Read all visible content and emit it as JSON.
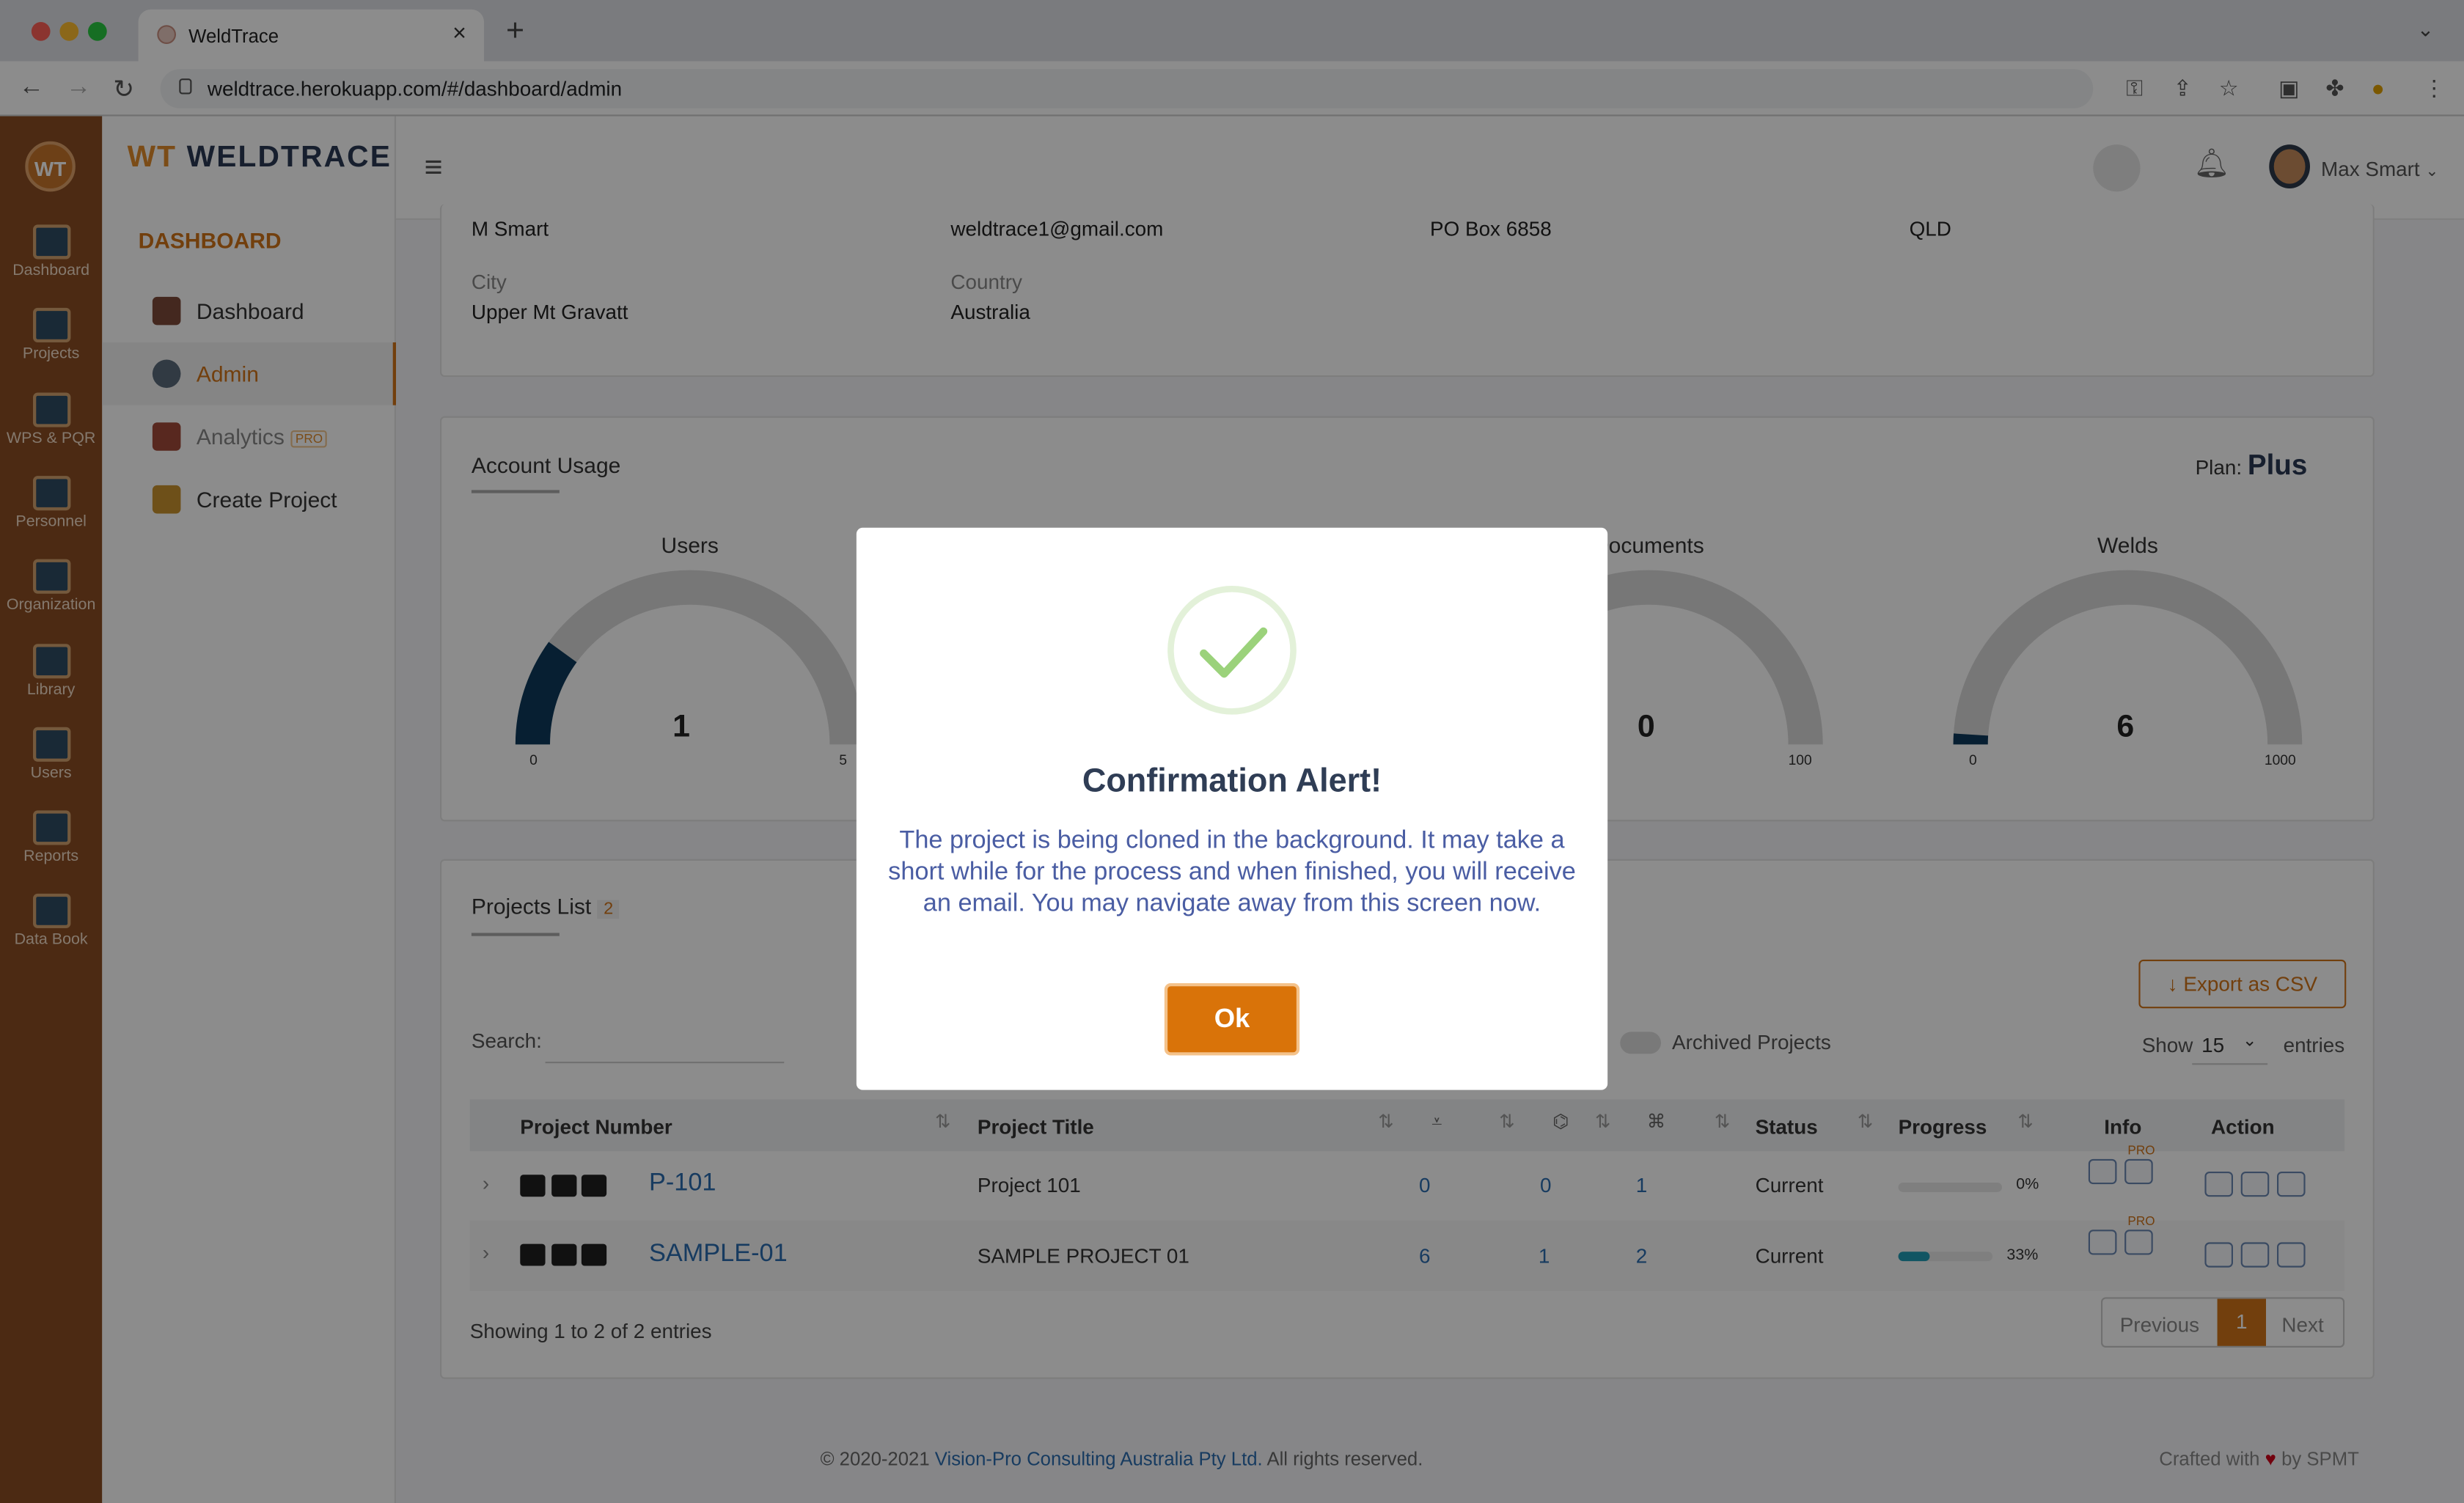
{
  "browser": {
    "tab_title": "WeldTrace",
    "url": "weldtrace.herokuapp.com/#/dashboard/admin"
  },
  "leftbar": {
    "logo": "WT",
    "items": [
      "Dashboard",
      "Projects",
      "WPS & PQR",
      "Personnel",
      "Organization",
      "Library",
      "Users",
      "Reports",
      "Data Book"
    ]
  },
  "sidebar": {
    "logo_prefix": "WT",
    "logo_text": "WELDTRACE",
    "section": "DASHBOARD",
    "items": [
      {
        "label": "Dashboard",
        "icon": "chart-icon"
      },
      {
        "label": "Admin",
        "icon": "gear-icon"
      },
      {
        "label": "Analytics",
        "icon": "analytics-icon",
        "badge": "PRO"
      },
      {
        "label": "Create Project",
        "icon": "folder-icon"
      }
    ]
  },
  "header": {
    "user_name": "Max Smart"
  },
  "profile": {
    "name": "M Smart",
    "email": "weldtrace1@gmail.com",
    "address": "PO Box 6858",
    "state": "QLD",
    "city_label": "City",
    "city": "Upper Mt Gravatt",
    "country_label": "Country",
    "country": "Australia"
  },
  "usage": {
    "title": "Account Usage",
    "plan_label": "Plan:",
    "plan": "Plus",
    "gauges": [
      {
        "title": "Users",
        "value": "1",
        "min": "0",
        "max": "5",
        "fraction": 0.2
      },
      {
        "title": "Documents",
        "value": "0",
        "min": "0",
        "max": "100",
        "fraction": 0
      },
      {
        "title": "Welds",
        "value": "6",
        "min": "0",
        "max": "1000",
        "fraction": 0.006
      }
    ]
  },
  "projects": {
    "title": "Projects List",
    "count": "2",
    "export_label": "Export as CSV",
    "search_label": "Search:",
    "archived_label": "Archived Projects",
    "show_label": "Show",
    "show_value": "15",
    "entries_label": "entries",
    "columns": {
      "number": "Project Number",
      "title": "Project Title",
      "status": "Status",
      "progress": "Progress",
      "info": "Info",
      "action": "Action"
    },
    "rows": [
      {
        "number": "P-101",
        "title": "Project 101",
        "c1": "0",
        "c2": "0",
        "c3": "1",
        "status": "Current",
        "progress": "0%",
        "progress_fraction": 0
      },
      {
        "number": "SAMPLE-01",
        "title": "SAMPLE PROJECT 01",
        "c1": "6",
        "c2": "1",
        "c3": "2",
        "status": "Current",
        "progress": "33%",
        "progress_fraction": 0.33
      }
    ],
    "pro_badge": "PRO",
    "footer_text": "Showing 1 to 2 of 2 entries",
    "prev_label": "Previous",
    "page": "1",
    "next_label": "Next"
  },
  "footer": {
    "copyright": "© 2020-2021",
    "company": "Vision-Pro Consulting Australia Pty Ltd.",
    "rights": "All rights reserved.",
    "crafted": "Crafted with",
    "by": "by SPMT"
  },
  "modal": {
    "title": "Confirmation Alert!",
    "message": "The project is being cloned in the background. It may take a short while for the process and when finished, you will receive an email. You may navigate away from this screen now.",
    "ok_label": "Ok"
  },
  "colors": {
    "accent": "#d97309",
    "brand_dark": "#8a4e23",
    "link": "#2b6cb0",
    "gauge_fill": "#0d3a5c"
  }
}
